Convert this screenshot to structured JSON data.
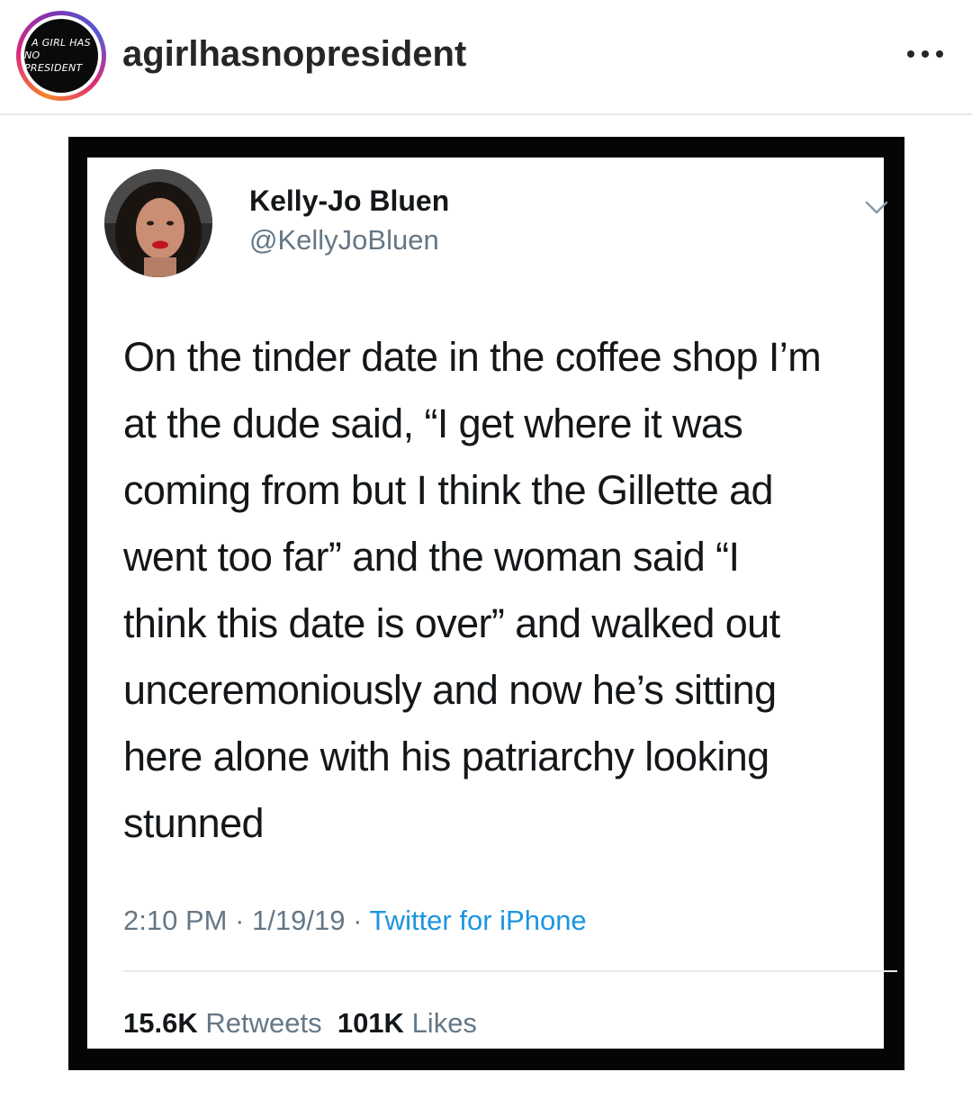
{
  "post": {
    "username": "agirlhasnopresident",
    "avatar_text_line1": "A GIRL HAS",
    "avatar_text_line2": "NO PRESIDENT",
    "more_icon": "ellipsis-icon"
  },
  "tweet": {
    "display_name": "Kelly-Jo Bluen",
    "handle": "@KellyJoBluen",
    "text": "On the tinder date in the coffee shop I’m\nat the dude said, “I get where it was\ncoming from but I think the Gillette ad\nwent too far” and the woman said “I\nthink this date is over” and walked out\nunceremoniously and  now he’s sitting\nhere alone with his patriarchy looking\nstunned",
    "time": "2:10 PM",
    "date": "1/19/19",
    "separator": " · ",
    "source": "Twitter for iPhone",
    "retweets_count": "15.6K",
    "retweets_label": "Retweets",
    "likes_count": "101K",
    "likes_label": "Likes"
  },
  "colors": {
    "frame": "#050505",
    "handle_gray": "#657786",
    "link_blue": "#1b95e0",
    "text_dark": "#14171a"
  }
}
